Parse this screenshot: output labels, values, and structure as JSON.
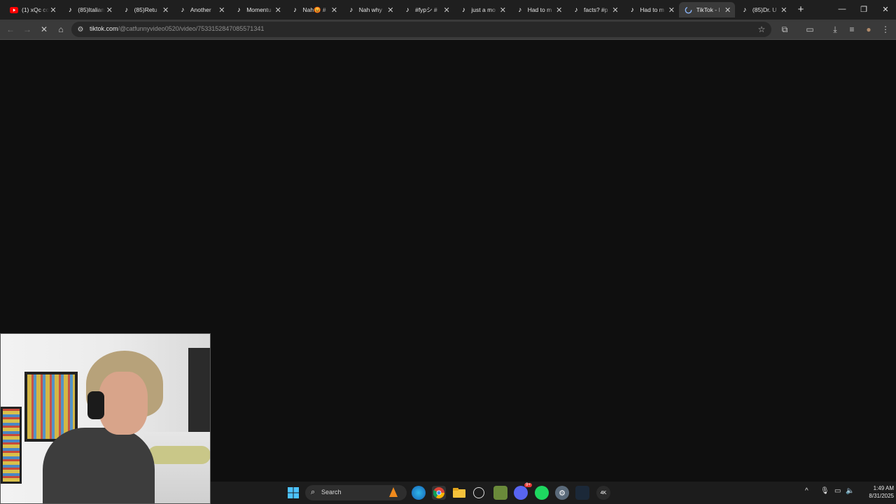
{
  "tabs": [
    {
      "title": "(1) xQc co",
      "icon": "youtube-icon"
    },
    {
      "title": "(85)Italian",
      "icon": "tiktok-icon"
    },
    {
      "title": "(85)Retu",
      "icon": "tiktok-icon"
    },
    {
      "title": "Another",
      "icon": "tiktok-icon"
    },
    {
      "title": "Momentu",
      "icon": "tiktok-icon"
    },
    {
      "title": "Nah😡 #",
      "icon": "tiktok-icon"
    },
    {
      "title": "Nah why",
      "icon": "tiktok-icon"
    },
    {
      "title": "#fypシ #",
      "icon": "tiktok-icon"
    },
    {
      "title": "just a mo",
      "icon": "tiktok-icon"
    },
    {
      "title": "Had to m",
      "icon": "tiktok-icon"
    },
    {
      "title": "facts? #p",
      "icon": "tiktok-icon"
    },
    {
      "title": "Had to m",
      "icon": "tiktok-icon"
    },
    {
      "title": "TikTok - I",
      "icon": "loading-icon",
      "active": true
    },
    {
      "title": "(85)Dr. U",
      "icon": "tiktok-icon"
    }
  ],
  "tab_close_glyph": "✕",
  "new_tab_glyph": "+",
  "window_controls": {
    "minimize": "—",
    "restore": "❐",
    "close": "✕"
  },
  "toolbar": {
    "back": "←",
    "forward": "→",
    "stop": "✕",
    "home": "⌂",
    "site_info": "⚙",
    "bookmark": "☆",
    "extensions": "⧉",
    "cast": "▭",
    "downloads": "⤓",
    "media": "≡",
    "profile": "●",
    "menu": "⋮"
  },
  "url": {
    "host": "tiktok.com",
    "path": "/@catfunnyvideo0520/video/7533152847085571341"
  },
  "taskbar": {
    "search_label": "Search",
    "start_icon": "windows-start-icon",
    "apps": [
      "vlc-icon",
      "edge-icon",
      "chrome-icon",
      "file-explorer-icon",
      "app-icon",
      "minecraft-icon",
      "discord-icon",
      "spotify-icon",
      "settings-icon",
      "steam-icon",
      "4k-video-downloader-icon"
    ],
    "discord_badge": "9+",
    "four_k_label": "4K"
  },
  "clock": {
    "time": "1:49 AM",
    "date": "8/31/2025"
  },
  "colors": {
    "accent_blue": "#0078d4",
    "tiktok_white": "#ffffff",
    "spotify_green": "#1ed760",
    "discord": "#5865f2"
  }
}
